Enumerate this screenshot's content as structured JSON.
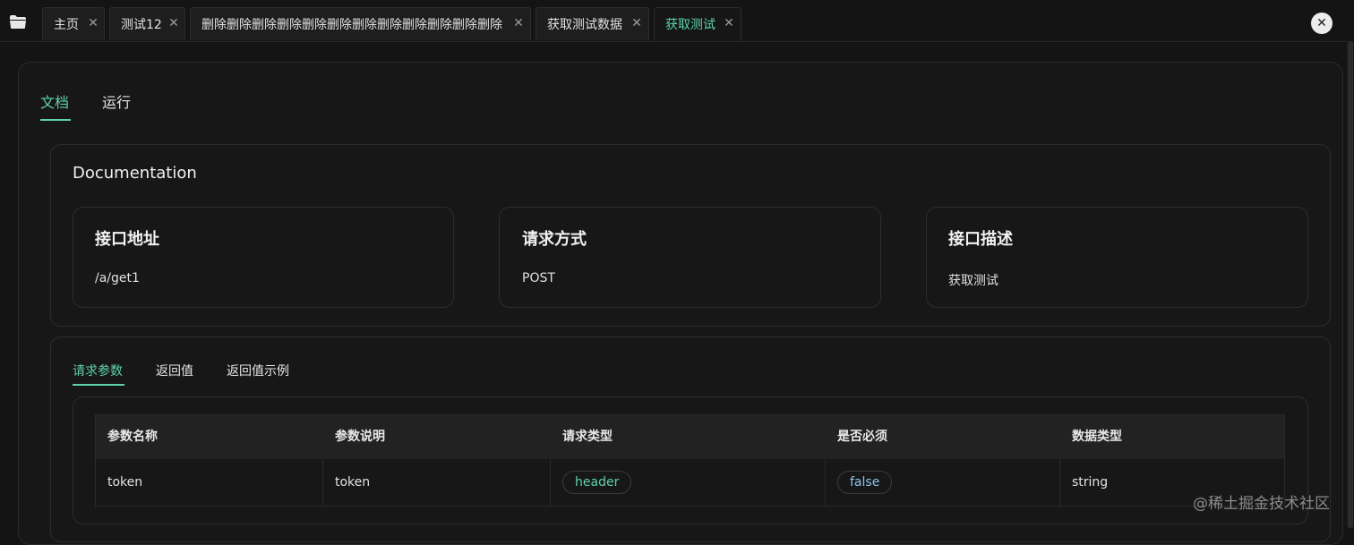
{
  "tabs": [
    {
      "label": "主页"
    },
    {
      "label": "测试12"
    },
    {
      "label": "删除删除删除删除删除删除删除删除删除删除删除删除"
    },
    {
      "label": "获取测试数据"
    },
    {
      "label": "获取测试"
    }
  ],
  "close_symbol": "✕",
  "page_tabs": {
    "docs": "文档",
    "run": "运行"
  },
  "doc": {
    "title": "Documentation",
    "cards": [
      {
        "title": "接口地址",
        "value": "/a/get1"
      },
      {
        "title": "请求方式",
        "value": "POST"
      },
      {
        "title": "接口描述",
        "value": "获取测试"
      }
    ]
  },
  "section_tabs": {
    "params": "请求参数",
    "returns": "返回值",
    "returns_example": "返回值示例"
  },
  "table": {
    "headers": [
      "参数名称",
      "参数说明",
      "请求类型",
      "是否必须",
      "数据类型"
    ],
    "rows": [
      {
        "name": "token",
        "desc": "token",
        "req_type": "header",
        "required": "false",
        "data_type": "string"
      }
    ]
  },
  "watermark": "@稀土掘金技术社区",
  "colors": {
    "accent": "#5fd3a7",
    "background": "#141414",
    "pill_blue": "#8fc4ea"
  }
}
